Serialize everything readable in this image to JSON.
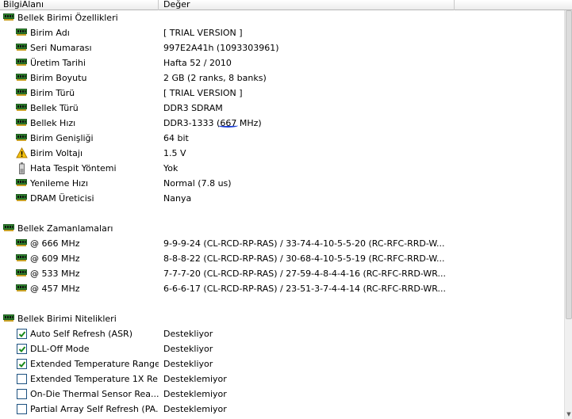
{
  "columns": {
    "field": "BilgiAlanı",
    "value": "Değer"
  },
  "sections": {
    "props_title": "Bellek Birimi Özellikleri",
    "props": [
      {
        "label": "Birim Adı",
        "value": "[ TRIAL VERSION ]",
        "icon": "ram-icon"
      },
      {
        "label": "Seri Numarası",
        "value": "997E2A41h (1093303961)",
        "icon": "ram-icon"
      },
      {
        "label": "Üretim Tarihi",
        "value": "Hafta 52 / 2010",
        "icon": "ram-icon"
      },
      {
        "label": "Birim Boyutu",
        "value": "2 GB (2 ranks, 8 banks)",
        "icon": "ram-icon"
      },
      {
        "label": "Birim Türü",
        "value": "[ TRIAL VERSION ]",
        "icon": "ram-icon"
      },
      {
        "label": "Bellek Türü",
        "value": "DDR3 SDRAM",
        "icon": "ram-icon"
      },
      {
        "label": "Bellek Hızı",
        "value_prefix": "DDR3-1333 (",
        "value_highlight": "667",
        "value_suffix": " MHz)",
        "icon": "ram-icon"
      },
      {
        "label": "Birim Genişliği",
        "value": "64 bit",
        "icon": "ram-icon"
      },
      {
        "label": "Birim Voltajı",
        "value": "1.5 V",
        "icon": "warning-icon"
      },
      {
        "label": "Hata Tespit Yöntemi",
        "value": "Yok",
        "icon": "battery-icon"
      },
      {
        "label": "Yenileme Hızı",
        "value": "Normal (7.8 us)",
        "icon": "ram-icon"
      },
      {
        "label": "DRAM Üreticisi",
        "value": "Nanya",
        "icon": "ram-icon"
      }
    ],
    "timings_title": "Bellek Zamanlamaları",
    "timings": [
      {
        "label": "@ 666 MHz",
        "value": "9-9-9-24  (CL-RCD-RP-RAS) / 33-74-4-10-5-5-20  (RC-RFC-RRD-W..."
      },
      {
        "label": "@ 609 MHz",
        "value": "8-8-8-22  (CL-RCD-RP-RAS) / 30-68-4-10-5-5-19  (RC-RFC-RRD-W..."
      },
      {
        "label": "@ 533 MHz",
        "value": "7-7-7-20  (CL-RCD-RP-RAS) / 27-59-4-8-4-4-16  (RC-RFC-RRD-WR..."
      },
      {
        "label": "@ 457 MHz",
        "value": "6-6-6-17  (CL-RCD-RP-RAS) / 23-51-3-7-4-4-14  (RC-RFC-RRD-WR..."
      }
    ],
    "features_title": "Bellek Birimi Nitelikleri",
    "features": [
      {
        "label": "Auto Self Refresh (ASR)",
        "value": "Destekliyor",
        "checked": true
      },
      {
        "label": "DLL-Off Mode",
        "value": "Destekliyor",
        "checked": true
      },
      {
        "label": "Extended Temperature Range",
        "value": "Destekliyor",
        "checked": true
      },
      {
        "label": "Extended Temperature 1X Re...",
        "value": "Desteklemiyor",
        "checked": false
      },
      {
        "label": "On-Die Thermal Sensor Rea...",
        "value": "Desteklemiyor",
        "checked": false
      },
      {
        "label": "Partial Array Self Refresh (PA...",
        "value": "Desteklemiyor",
        "checked": false
      }
    ]
  },
  "colors": {
    "ram_green": "#2f8a2f",
    "ram_pins": "#c9a227",
    "highlight": "#1c3fd6"
  }
}
